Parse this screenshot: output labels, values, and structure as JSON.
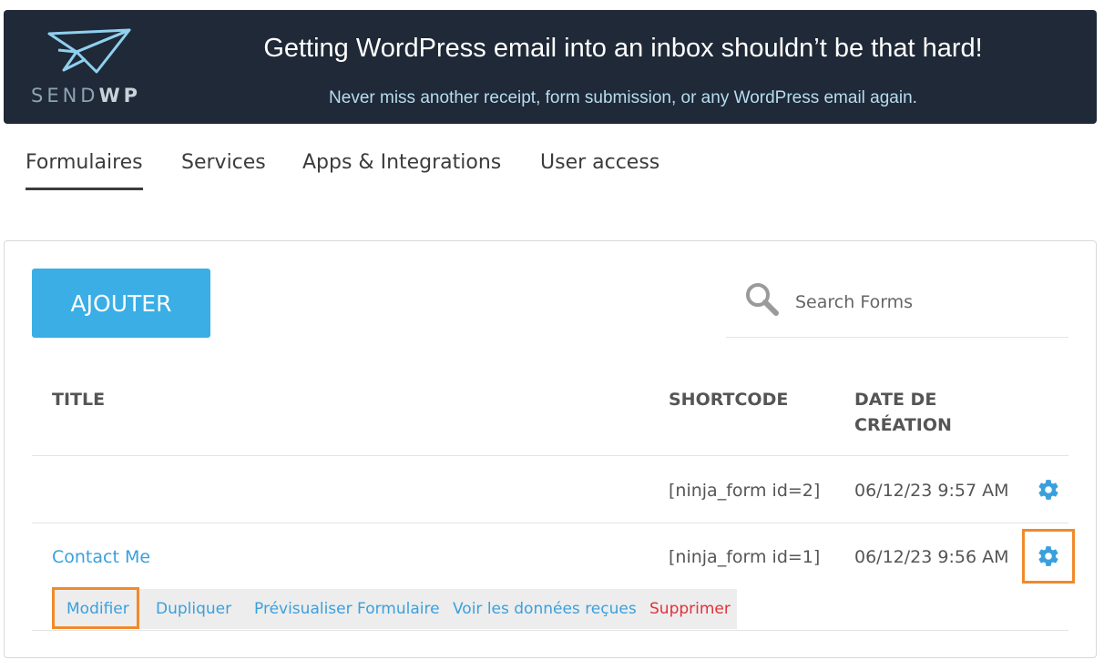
{
  "banner": {
    "logo_text_light": "SEND",
    "logo_text_bold": "WP",
    "headline": "Getting WordPress email into an inbox shouldn’t be that hard!",
    "subline": "Never miss another receipt, form submission, or any WordPress email again."
  },
  "tabs": [
    {
      "label": "Formulaires",
      "active": true
    },
    {
      "label": "Services",
      "active": false
    },
    {
      "label": "Apps & Integrations",
      "active": false
    },
    {
      "label": "User access",
      "active": false
    }
  ],
  "toolbar": {
    "add_label": "AJOUTER",
    "search_placeholder": "Search Forms"
  },
  "table": {
    "headers": {
      "title": "TITLE",
      "shortcode": "SHORTCODE",
      "date_line1": "DATE DE",
      "date_line2": "CRÉATION"
    },
    "rows": [
      {
        "title": "",
        "shortcode": "[ninja_form id=2]",
        "date": "06/12/23 9:57 AM"
      },
      {
        "title": "Contact Me",
        "shortcode": "[ninja_form id=1]",
        "date": "06/12/23 9:56 AM"
      }
    ],
    "row_actions": {
      "edit": "Modifier",
      "duplicate": "Dupliquer",
      "preview": "Prévisualiser Formulaire",
      "submissions": "Voir les données reçues",
      "delete": "Supprimer"
    }
  },
  "colors": {
    "accent": "#3aaee5",
    "link": "#3aa0dd",
    "danger": "#e0323a",
    "highlight": "#f08a2b",
    "banner_bg": "#1f2937"
  }
}
